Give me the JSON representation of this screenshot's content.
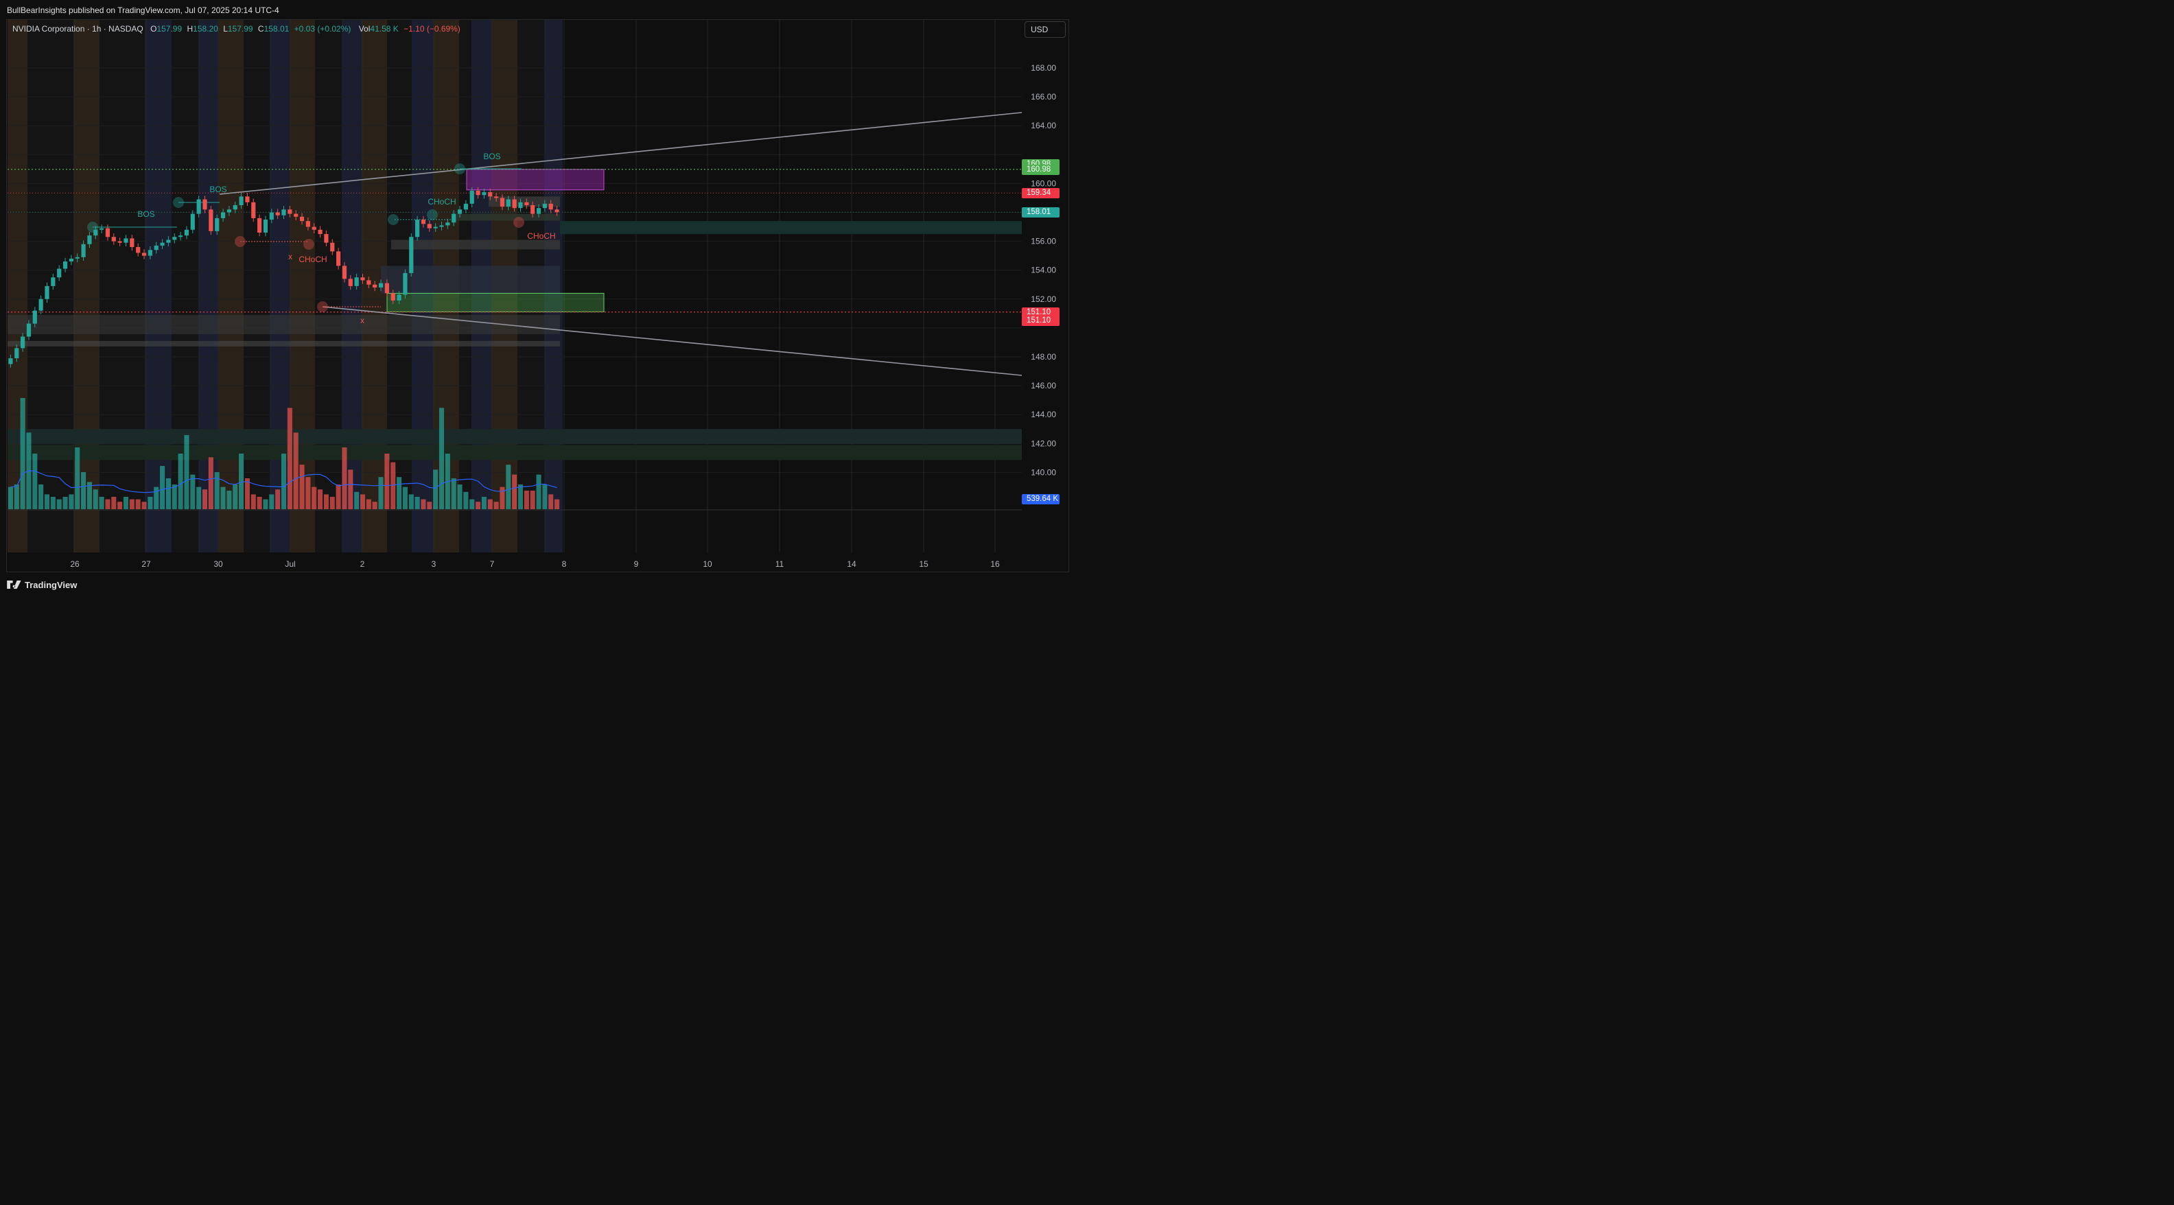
{
  "header": {
    "publisher": "BullBearInsights published on TradingView.com, Jul 07, 2025 20:14 UTC-4",
    "currency_button": "USD"
  },
  "legend": {
    "symbol": "NVIDIA Corporation · 1h · NASDAQ",
    "o_label": "O",
    "o_value": "157.99",
    "h_label": "H",
    "h_value": "158.20",
    "l_label": "L",
    "l_value": "157.99",
    "c_label": "C",
    "c_value": "158.01",
    "change": "+0.03 (+0.02%)",
    "vol_label": "Vol",
    "vol_value": "41.58 K",
    "vol_change": "−1.10 (−0.69%)"
  },
  "footer": {
    "brand": "TradingView"
  },
  "colors": {
    "bull": "#26a69a",
    "bear": "#ef5350",
    "supply_zone": "#9c27b0",
    "demand_zone": "#4caf50",
    "volume_ma": "#2962ff",
    "trendline": "#9598a1",
    "resistance_dotted": "#4caf50",
    "support_dotted": "#f23645"
  },
  "chart_data": {
    "type": "candlestick",
    "title": "NVIDIA Corporation · 1h · NASDAQ",
    "ylim": [
      146,
      169
    ],
    "y_ticks": [
      148,
      150,
      152,
      154,
      156,
      158,
      160,
      162,
      164,
      166,
      168
    ],
    "y_ticks_visible": [
      "140.00",
      "142.00",
      "144.00",
      "146.00",
      "148.00",
      "152.00",
      "154.00",
      "156.00",
      "160.00",
      "164.00",
      "166.00",
      "168.00"
    ],
    "x_ticks": [
      "26",
      "27",
      "30",
      "Jul",
      "2",
      "3",
      "7",
      "8",
      "9",
      "10",
      "11",
      "14",
      "15",
      "16"
    ],
    "price_labels": [
      {
        "text": "160.98",
        "price": 161.35,
        "color": "#4caf50"
      },
      {
        "text": "160.98",
        "price": 160.98,
        "color": "#4caf50"
      },
      {
        "text": "159.34",
        "price": 159.34,
        "color": "#f23645"
      },
      {
        "text": "158.01",
        "price": 158.01,
        "color": "#26a69a"
      },
      {
        "text": "151.10",
        "price": 151.1,
        "color": "#f23645"
      },
      {
        "text": "151.10",
        "price": 150.5,
        "color": "#f23645"
      },
      {
        "text": "539.64 K",
        "price": null,
        "color": "#2962ff"
      }
    ],
    "annotations": [
      {
        "text": "BOS",
        "color": "#26a69a"
      },
      {
        "text": "BOS",
        "color": "#26a69a"
      },
      {
        "text": "BOS",
        "color": "#26a69a"
      },
      {
        "text": "CHoCH",
        "color": "#26a69a"
      },
      {
        "text": "CHoCH",
        "color": "#ef5350"
      },
      {
        "text": "CHoCH",
        "color": "#ef5350"
      },
      {
        "text": "x",
        "color": "#ef5350"
      },
      {
        "text": "x",
        "color": "#ef5350"
      }
    ],
    "levels": {
      "resistance": 160.98,
      "pivot": 159.34,
      "last": 158.01,
      "support": 151.1
    },
    "zones": [
      {
        "name": "supply",
        "from": 159.4,
        "to": 160.98
      },
      {
        "name": "demand",
        "from": 151.1,
        "to": 152.4
      }
    ],
    "candles_close": [
      147.9,
      148.6,
      149.4,
      150.3,
      151.2,
      152.0,
      152.9,
      153.5,
      154.1,
      154.6,
      154.8,
      154.9,
      155.8,
      156.4,
      156.8,
      156.9,
      156.3,
      156.0,
      155.9,
      156.2,
      155.6,
      155.2,
      155.0,
      155.4,
      155.7,
      155.9,
      156.1,
      156.3,
      156.4,
      156.8,
      157.9,
      158.9,
      158.2,
      156.7,
      157.6,
      158.0,
      158.2,
      158.5,
      159.1,
      158.7,
      157.6,
      156.6,
      157.5,
      158.0,
      157.8,
      158.2,
      157.9,
      157.7,
      157.4,
      157.0,
      156.8,
      156.5,
      155.9,
      155.3,
      154.3,
      153.4,
      152.9,
      153.5,
      153.3,
      153.0,
      152.8,
      153.1,
      152.4,
      151.9,
      152.3,
      153.8,
      156.3,
      157.5,
      157.2,
      156.9,
      157.0,
      157.1,
      157.3,
      157.9,
      158.2,
      158.6,
      159.5,
      159.2,
      159.4,
      159.1,
      159.0,
      158.4,
      158.9,
      158.3,
      158.7,
      158.5,
      157.9,
      158.3,
      158.6,
      158.2,
      158.01
    ],
    "volume_relative": [
      0.18,
      0.2,
      0.9,
      0.62,
      0.45,
      0.2,
      0.12,
      0.1,
      0.08,
      0.1,
      0.12,
      0.5,
      0.3,
      0.22,
      0.16,
      0.1,
      0.08,
      0.1,
      0.06,
      0.1,
      0.08,
      0.08,
      0.06,
      0.1,
      0.18,
      0.35,
      0.25,
      0.2,
      0.45,
      0.6,
      0.28,
      0.18,
      0.16,
      0.42,
      0.3,
      0.18,
      0.15,
      0.2,
      0.45,
      0.25,
      0.12,
      0.1,
      0.08,
      0.12,
      0.16,
      0.45,
      0.82,
      0.62,
      0.36,
      0.26,
      0.18,
      0.16,
      0.12,
      0.1,
      0.2,
      0.5,
      0.32,
      0.14,
      0.12,
      0.08,
      0.06,
      0.26,
      0.45,
      0.38,
      0.26,
      0.18,
      0.12,
      0.1,
      0.08,
      0.06,
      0.32,
      0.82,
      0.45,
      0.25,
      0.2,
      0.14,
      0.08,
      0.06,
      0.1,
      0.08,
      0.06,
      0.18,
      0.36,
      0.28,
      0.2,
      0.15,
      0.15,
      0.28,
      0.2,
      0.12,
      0.08
    ]
  }
}
